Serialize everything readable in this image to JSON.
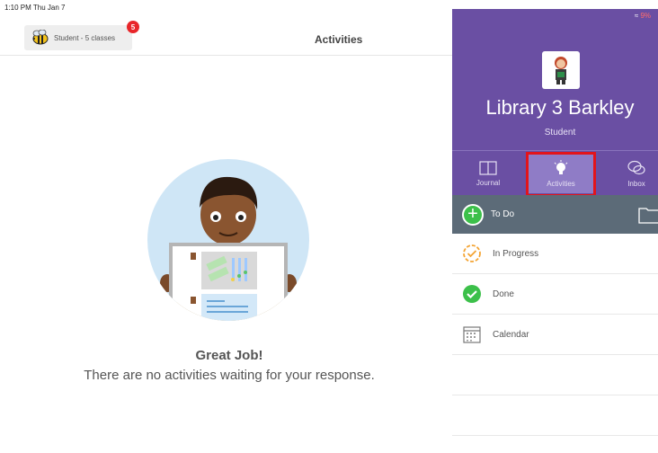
{
  "status_bar": {
    "time": "1:10 PM  Thu Jan 7",
    "battery": "9%"
  },
  "header": {
    "account_label": "Student - 5 classes",
    "notification_count": "5",
    "title": "Activities"
  },
  "empty_state": {
    "title": "Great Job!",
    "message": "There are no activities waiting for your response."
  },
  "panel": {
    "user_name": "Library 3 Barkley",
    "user_role": "Student",
    "tabs": [
      {
        "label": "Journal",
        "icon": "book-icon"
      },
      {
        "label": "Activities",
        "icon": "lightbulb-icon",
        "selected": true
      },
      {
        "label": "Inbox",
        "icon": "chat-icon"
      }
    ],
    "todo_label": "To Do",
    "list": [
      {
        "label": "In Progress",
        "icon": "in-progress-icon"
      },
      {
        "label": "Done",
        "icon": "done-check-icon"
      },
      {
        "label": "Calendar",
        "icon": "calendar-icon"
      }
    ]
  },
  "colors": {
    "panel_purple": "#6a4fa3",
    "tab_highlight": "#8f7cc6",
    "selection_frame": "#e3141b",
    "todo_bar": "#5c6b78",
    "green": "#3cc04a",
    "orange": "#f4a433",
    "badge_red": "#e8262a"
  }
}
